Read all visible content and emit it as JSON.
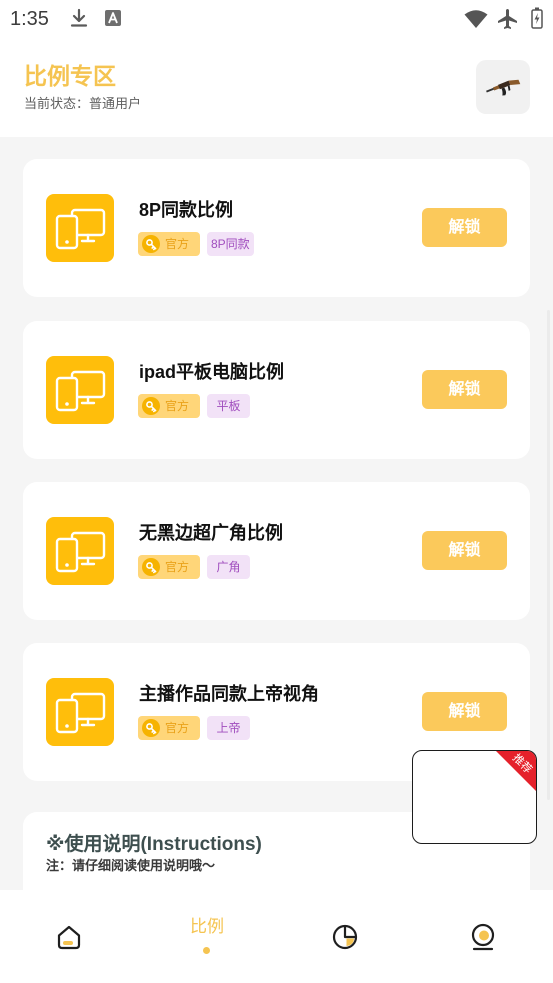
{
  "status_bar": {
    "time": "1:35",
    "left_icons": [
      "download-icon",
      "a-notification-icon"
    ],
    "right_icons": [
      "wifi-icon",
      "airplane-mode-icon",
      "battery-charging-icon"
    ]
  },
  "header": {
    "title": "比例专区",
    "status_text": "当前状态：普通用户",
    "action_icon": "rifle-icon"
  },
  "cards": [
    {
      "title": "8P同款比例",
      "official_tag": "官方",
      "category_tag": "8P同款",
      "button_label": "解锁",
      "icon": "phone-monitor-icon"
    },
    {
      "title": "ipad平板电脑比例",
      "official_tag": "官方",
      "category_tag": "平板",
      "button_label": "解锁",
      "icon": "phone-monitor-icon"
    },
    {
      "title": "无黑边超广角比例",
      "official_tag": "官方",
      "category_tag": "广角",
      "button_label": "解锁",
      "icon": "phone-monitor-icon"
    },
    {
      "title": "主播作品同款上帝视角",
      "official_tag": "官方",
      "category_tag": "上帝",
      "button_label": "解锁",
      "icon": "phone-monitor-icon"
    }
  ],
  "instructions": {
    "title": "※使用说明(Instructions)",
    "note": "注：请仔细阅读使用说明哦～"
  },
  "floating_panel": {
    "ribbon_label": "推荐"
  },
  "bottom_nav": {
    "active_index": 1,
    "items": [
      {
        "icon": "home-icon"
      },
      {
        "label": "比例"
      },
      {
        "icon": "pie-chart-icon"
      },
      {
        "icon": "profile-icon"
      }
    ]
  },
  "colors": {
    "accent": "#F5C451",
    "icon_tile": "#FFBE0B",
    "unlock_button": "#FBC95B",
    "official_tag_bg": "#FFD679",
    "official_tag_text": "#E9A21A",
    "category_tag_bg": "#F2E2F7",
    "category_tag_text": "#A04DBE",
    "ribbon": "#E5212B",
    "page_bg": "#F5F5F5",
    "instructions_title": "#3E4F4F"
  }
}
